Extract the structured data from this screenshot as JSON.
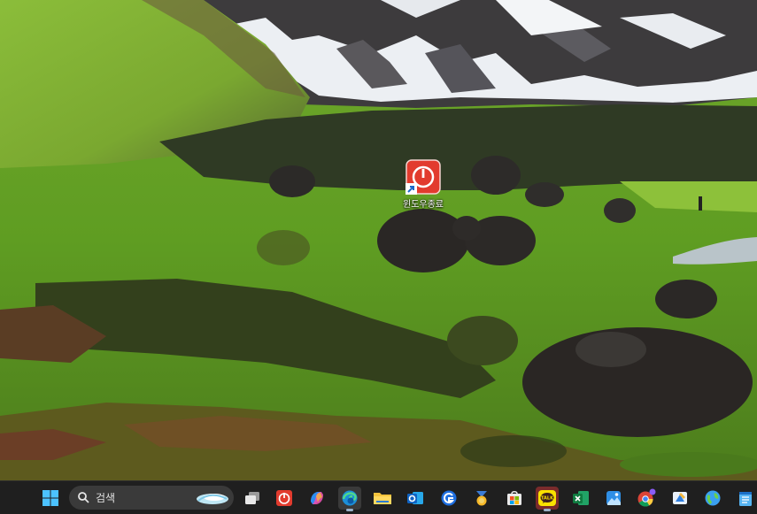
{
  "desktop": {
    "icons": [
      {
        "label": "윈도우종료",
        "icon": "power-shortcut-icon",
        "color": "#e23b2e"
      }
    ]
  },
  "taskbar": {
    "search": {
      "label": "검색",
      "icon": "search-icon"
    },
    "apps": [
      {
        "name": "start",
        "icon": "windows-logo-icon"
      },
      {
        "name": "task-view",
        "icon": "task-view-icon"
      },
      {
        "name": "shutdown",
        "icon": "power-icon"
      },
      {
        "name": "copilot",
        "icon": "copilot-icon"
      },
      {
        "name": "edge",
        "icon": "edge-icon"
      },
      {
        "name": "file-explorer",
        "icon": "folder-icon"
      },
      {
        "name": "outlook",
        "icon": "outlook-icon"
      },
      {
        "name": "app-g",
        "icon": "g-app-icon"
      },
      {
        "name": "app-medal",
        "icon": "medal-icon"
      },
      {
        "name": "store",
        "icon": "store-icon"
      },
      {
        "name": "kakaotalk",
        "icon": "kakaotalk-icon",
        "badge": "TALK"
      },
      {
        "name": "excel",
        "icon": "excel-icon"
      },
      {
        "name": "photos",
        "icon": "photos-icon"
      },
      {
        "name": "chrome",
        "icon": "chrome-icon"
      },
      {
        "name": "paint",
        "icon": "paint-icon"
      },
      {
        "name": "maps",
        "icon": "globe-icon"
      },
      {
        "name": "notepad",
        "icon": "notepad-icon"
      }
    ]
  }
}
